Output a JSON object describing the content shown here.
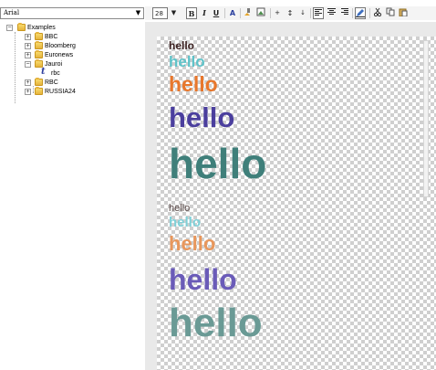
{
  "font_selector": {
    "value": "Arial"
  },
  "tree": {
    "root": {
      "label": "Examples"
    },
    "items": [
      {
        "label": "BBC"
      },
      {
        "label": "Bloomberg"
      },
      {
        "label": "Euronews"
      },
      {
        "label": "Jauroi",
        "children": [
          {
            "label": "rbc"
          }
        ]
      },
      {
        "label": "RBC"
      },
      {
        "label": "RUSSIA24"
      }
    ]
  },
  "toolbar": {
    "font_size": "28",
    "bold": "B",
    "italic": "I",
    "underline": "U",
    "text_color": "A",
    "superscript": "+",
    "line_spacing": "↕",
    "subscript": "↓"
  },
  "editor": {
    "samples": [
      {
        "text": "hello",
        "color": "#3a1f1f"
      },
      {
        "text": "hello",
        "color": "#5fc3c9"
      },
      {
        "text": "hello",
        "color": "#e8772c"
      },
      {
        "text": "hello",
        "color": "#4b3f9e"
      },
      {
        "text": "hello",
        "color": "#3f7f7a"
      },
      {
        "text": "hello",
        "color": "#5a4a48"
      },
      {
        "text": "hello",
        "color": "#7fd0d8"
      },
      {
        "text": "hello",
        "color": "#e8975c"
      },
      {
        "text": "hello",
        "color": "#6a5bb8"
      },
      {
        "text": "hello",
        "color": "#6a9a95"
      }
    ]
  }
}
